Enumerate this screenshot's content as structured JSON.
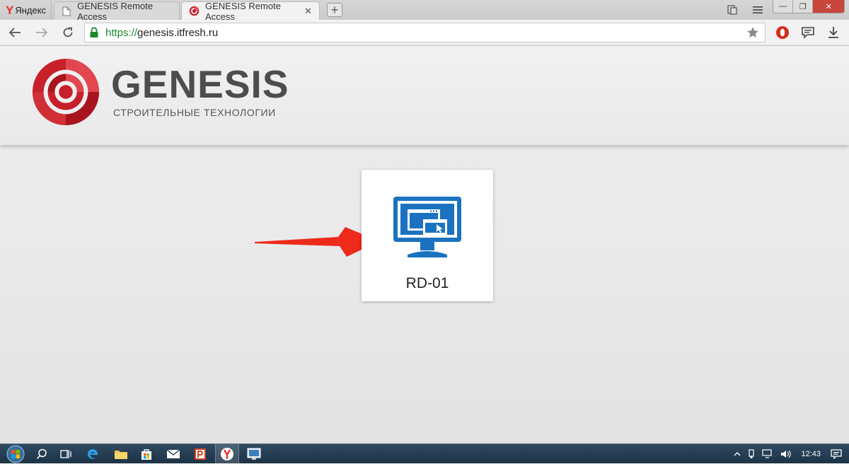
{
  "browser": {
    "yandex_tab": {
      "logo": "Y",
      "label": "Яндекс"
    },
    "tabs": [
      {
        "title": "GENESIS Remote Access",
        "icon": "document-icon",
        "active": false
      },
      {
        "title": "GENESIS Remote Access",
        "icon": "genesis-favicon",
        "active": true
      }
    ],
    "new_tab_label": "+",
    "close_glyph": "✕",
    "address": {
      "scheme": "https://",
      "host": "genesis.itfresh.ru"
    },
    "window_controls": {
      "minimize": "—",
      "maximize": "❐",
      "close": "✕"
    }
  },
  "page": {
    "logo": {
      "word": "GENESIS",
      "subtitle": "СТРОИТЕЛЬНЫЕ ТЕХНОЛОГИИ"
    },
    "resources": [
      {
        "label": "RD-01",
        "icon": "remote-desktop-icon"
      }
    ]
  },
  "taskbar": {
    "clock": "12:43",
    "apps": [
      "start",
      "search",
      "task-view",
      "edge",
      "explorer",
      "store",
      "mail",
      "powerpoint",
      "yandex-browser",
      "remote-desktop"
    ]
  },
  "colors": {
    "brand_red": "#c8202a",
    "brand_gray": "#4d4d4d",
    "icon_blue": "#1b72c0",
    "arrow_red": "#ee2a1b",
    "secure_green": "#1a8a2e"
  }
}
